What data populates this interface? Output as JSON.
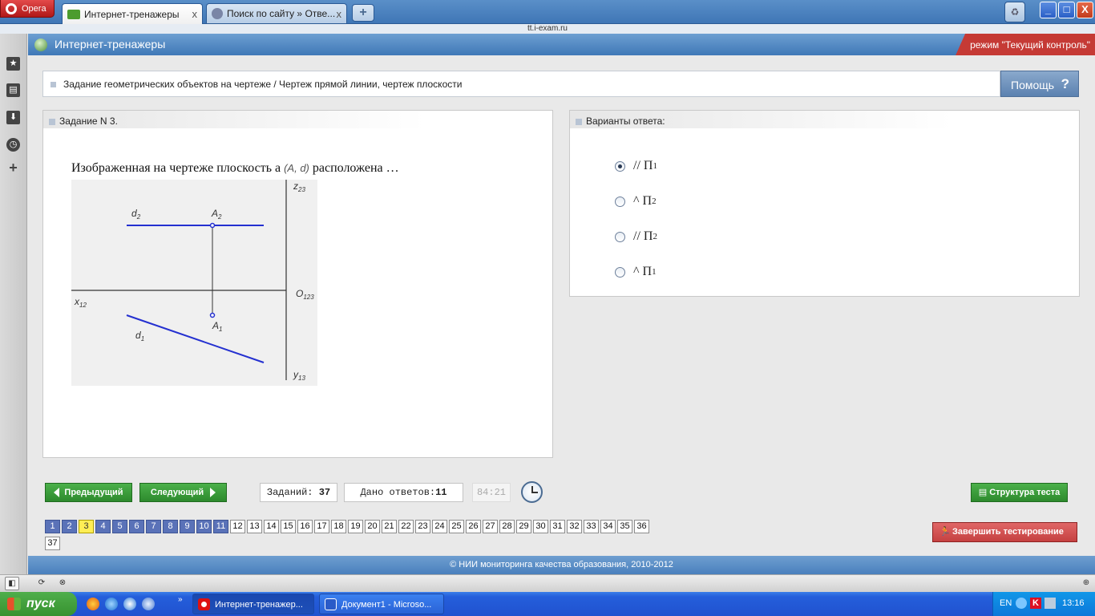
{
  "browser": {
    "opera_label": "Opera",
    "tabs": [
      {
        "title": "Интернет-тренажеры",
        "close": "x"
      },
      {
        "title": "Поиск по сайту » Отве...",
        "close": "x"
      }
    ],
    "new_tab": "+",
    "url": "tt.i-exam.ru",
    "window_controls": {
      "minimize": "_",
      "maximize": "□",
      "close": "X"
    }
  },
  "sidebar": {
    "items": [
      "bookmarks-icon",
      "notes-icon",
      "downloads-icon",
      "history-icon",
      "add-panel-icon"
    ]
  },
  "header": {
    "title": "Интернет-тренажеры",
    "mode": "режим \"Текущий контроль\""
  },
  "breadcrumb": "Задание геометрических объектов на чертеже / Чертеж прямой линии, чертеж плоскости",
  "help": {
    "label": "Помощь",
    "icon": "?"
  },
  "task": {
    "header": "Задание N 3.",
    "question_pre": "Изображенная на чертеже плоскость a ",
    "question_math": "(A, d)",
    "question_post": " расположена …",
    "drawing_labels": {
      "d2": "d",
      "d2_sub": "2",
      "A2": "A",
      "A2_sub": "2",
      "z": "z",
      "z_sub": "23",
      "o": "O",
      "o_sub": "123",
      "x": "x",
      "x_sub": "12",
      "A1": "A",
      "A1_sub": "1",
      "d1": "d",
      "d1_sub": "1",
      "y": "y",
      "y_sub": "13"
    }
  },
  "answers": {
    "header": "Варианты ответа:",
    "options": [
      {
        "symbol": "//",
        "letter": "П",
        "sub": "1",
        "selected": true
      },
      {
        "symbol": "^",
        "letter": "П",
        "sub": "2",
        "selected": false
      },
      {
        "symbol": "//",
        "letter": "П",
        "sub": "2",
        "selected": false
      },
      {
        "symbol": "^",
        "letter": "П",
        "sub": "1",
        "selected": false
      }
    ]
  },
  "nav": {
    "prev": "Предыдущий",
    "next": "Следующий",
    "tasks_label": "Заданий:",
    "tasks_value": "37",
    "answered_label": "Дано ответов:",
    "answered_value": "11",
    "timer": "84:21",
    "structure": "Структура теста",
    "finish": "Завершить тестирование",
    "question_numbers": [
      "1",
      "2",
      "3",
      "4",
      "5",
      "6",
      "7",
      "8",
      "9",
      "10",
      "11",
      "12",
      "13",
      "14",
      "15",
      "16",
      "17",
      "18",
      "19",
      "20",
      "21",
      "22",
      "23",
      "24",
      "25",
      "26",
      "27",
      "28",
      "29",
      "30",
      "31",
      "32",
      "33",
      "34",
      "35",
      "36",
      "37"
    ],
    "current": 3,
    "answered": [
      1,
      2,
      4,
      5,
      6,
      7,
      8,
      9,
      10,
      11
    ]
  },
  "footer": "© НИИ мониторинга качества образования, 2010-2012",
  "taskbar": {
    "start": "пуск",
    "windows": [
      {
        "title": "Интернет-тренажер...",
        "active": true
      },
      {
        "title": "Документ1 - Microso...",
        "active": false
      }
    ],
    "lang": "EN",
    "time": "13:16"
  },
  "colors": {
    "header_blue": "#4a80bd",
    "mode_red": "#c53a35",
    "green_button": "#37922f",
    "finish_red": "#c54141",
    "answered_blue": "#5a72b8",
    "current_yellow": "#ffee55",
    "drawing_line": "#2430d0"
  }
}
